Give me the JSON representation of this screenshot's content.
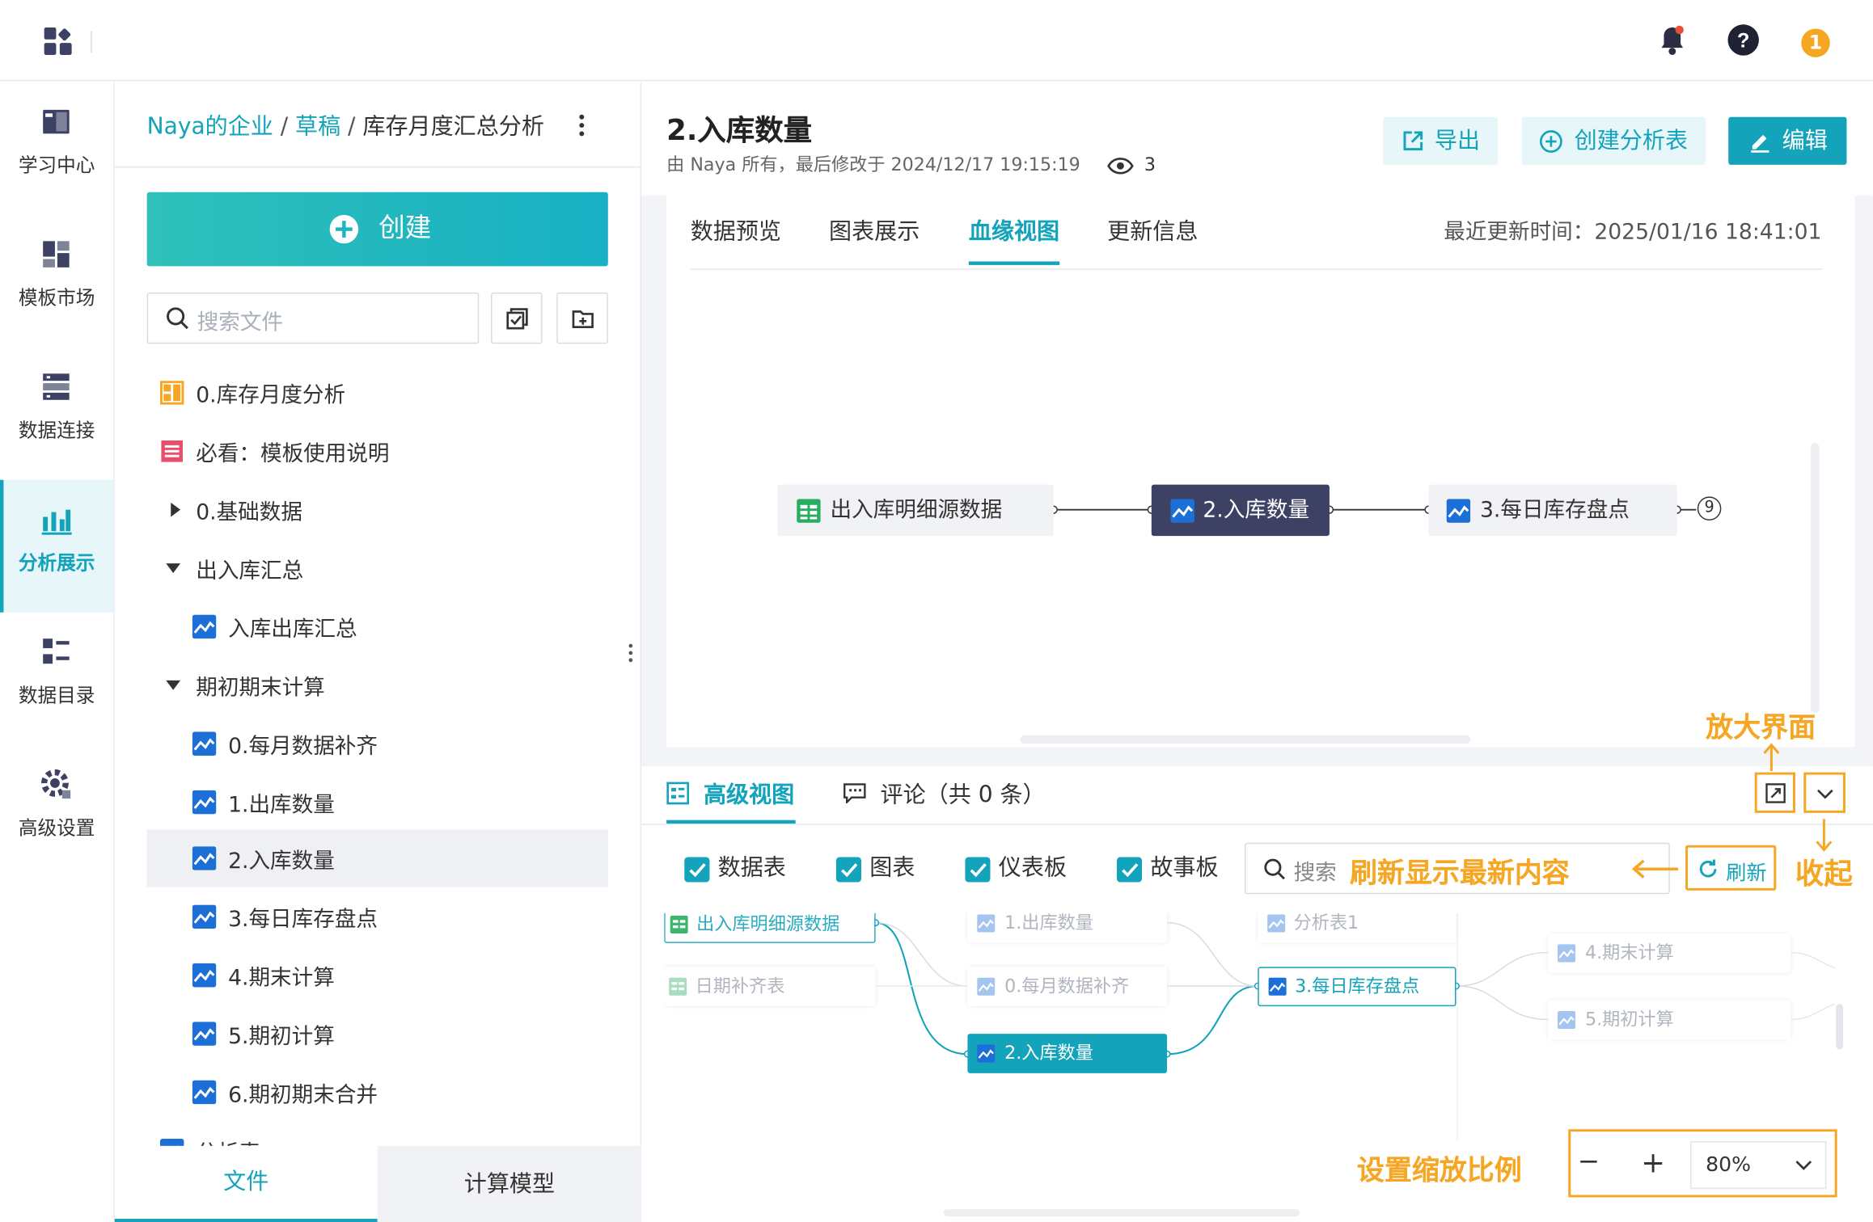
{
  "nav": {
    "items": [
      {
        "label": "学习中心",
        "icon": "book-icon"
      },
      {
        "label": "模板市场",
        "icon": "template-icon"
      },
      {
        "label": "数据连接",
        "icon": "database-icon"
      },
      {
        "label": "分析展示",
        "icon": "analysis-icon"
      },
      {
        "label": "数据目录",
        "icon": "catalog-icon"
      },
      {
        "label": "高级设置",
        "icon": "gear-icon"
      }
    ],
    "active": "分析展示"
  },
  "topbar": {
    "notification_badge_color": "#e74c3c",
    "user_avatar_text": "1",
    "user_avatar_color": "#f5a623"
  },
  "filepanel": {
    "breadcrumb": {
      "org": "Naya的企业",
      "sep1": "/",
      "folder": "草稿",
      "sep2": "/",
      "current": "库存月度汇总分析"
    },
    "create_label": "创建",
    "search_placeholder": "搜索文件",
    "tree": [
      {
        "label": "0.库存月度分析",
        "icon": "dashboard-icon"
      },
      {
        "label": "必看：模板使用说明",
        "icon": "document-icon"
      },
      {
        "label": "0.基础数据",
        "icon": "caret-right-icon"
      },
      {
        "label": "出入库汇总",
        "icon": "caret-down-icon"
      },
      {
        "label": "入库出库汇总",
        "icon": "chart-icon"
      },
      {
        "label": "期初期末计算",
        "icon": "caret-down-icon"
      },
      {
        "label": "0.每月数据补齐",
        "icon": "chart-icon"
      },
      {
        "label": "1.出库数量",
        "icon": "chart-icon"
      },
      {
        "label": "2.入库数量",
        "icon": "chart-icon"
      },
      {
        "label": "3.每日库存盘点",
        "icon": "chart-icon"
      },
      {
        "label": "4.期末计算",
        "icon": "chart-icon"
      },
      {
        "label": "5.期初计算",
        "icon": "chart-icon"
      },
      {
        "label": "6.期初期末合并",
        "icon": "chart-icon"
      },
      {
        "label": "分析表",
        "icon": "chart-icon"
      }
    ],
    "selected": "2.入库数量",
    "tabs": {
      "files": "文件",
      "model": "计算模型"
    }
  },
  "header": {
    "title": "2.入库数量",
    "meta": "由 Naya 所有，最后修改于 2024/12/17 19:15:19",
    "views": "3",
    "export_label": "导出",
    "create_table_label": "创建分析表",
    "edit_label": "编辑"
  },
  "lineage": {
    "tabs": [
      "数据预览",
      "图表展示",
      "血缘视图",
      "更新信息"
    ],
    "active_tab": "血缘视图",
    "update_time": "最近更新时间：2025/01/16 18:41:01",
    "nodes": {
      "source": "出入库明细源数据",
      "current": "2.入库数量",
      "next": "3.每日库存盘点",
      "more_count": "9"
    }
  },
  "advanced": {
    "tab_advanced": "高级视图",
    "tab_comments": "评论（共 0 条）",
    "filters": [
      "数据表",
      "图表",
      "仪表板",
      "故事板"
    ],
    "search_placeholder": "搜索",
    "refresh_label": "刷新",
    "graph_nodes": {
      "src1": "出入库明细源数据",
      "src2": "日期补齐表",
      "mid1": "1.出库数量",
      "mid2": "0.每月数据补齐",
      "mid3": "2.入库数量",
      "top_analysis": "分析表1",
      "stock": "3.每日库存盘点",
      "end1": "4.期末计算",
      "end2": "5.期初计算"
    },
    "zoom": {
      "value": "80%",
      "minus": "−",
      "plus": "+"
    }
  },
  "annotations": {
    "enlarge": "放大界面",
    "refresh_hint": "刷新显示最新内容",
    "collapse": "收起",
    "zoom_hint": "设置缩放比例",
    "color": "#f5a623"
  },
  "colors": {
    "accent": "#13a3ba",
    "dark_node": "#3d4163",
    "annotation": "#f5a623"
  }
}
